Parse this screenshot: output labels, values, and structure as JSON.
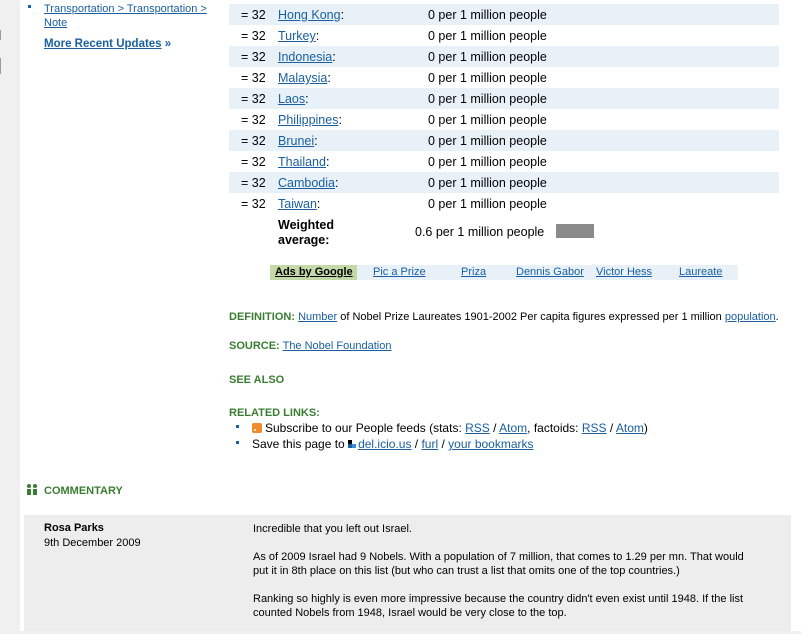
{
  "sidebar": {
    "recent_link": "Transportation > Transportation > Note",
    "more_recent": "More Recent Updates",
    "more_recent_suffix": "»"
  },
  "table": {
    "rows": [
      {
        "rank": "= 32",
        "country": "Hong Kong",
        "value": "0 per 1 million people"
      },
      {
        "rank": "= 32",
        "country": "Turkey",
        "value": "0 per 1 million people"
      },
      {
        "rank": "= 32",
        "country": "Indonesia",
        "value": "0 per 1 million people"
      },
      {
        "rank": "= 32",
        "country": "Malaysia",
        "value": "0 per 1 million people"
      },
      {
        "rank": "= 32",
        "country": "Laos",
        "value": "0 per 1 million people"
      },
      {
        "rank": "= 32",
        "country": "Philippines",
        "value": "0 per 1 million people"
      },
      {
        "rank": "= 32",
        "country": "Brunei",
        "value": "0 per 1 million people"
      },
      {
        "rank": "= 32",
        "country": "Thailand",
        "value": "0 per 1 million people"
      },
      {
        "rank": "= 32",
        "country": "Cambodia",
        "value": "0 per 1 million people"
      },
      {
        "rank": "= 32",
        "country": "Taiwan",
        "value": "0 per 1 million people"
      }
    ],
    "weighted_label_1": "Weighted",
    "weighted_label_2": "average:",
    "weighted_value": "0.6 per 1 million people"
  },
  "ads": {
    "label": "Ads by Google",
    "links": [
      "Pic a Prize",
      "Priza",
      "Dennis Gabor",
      "Victor Hess",
      "Laureate"
    ]
  },
  "definition": {
    "label": "DEFINITION:",
    "link1": "Number",
    "text": " of Nobel Prize Laureates 1901-2002 Per capita figures expressed per 1 million ",
    "link2": "population",
    "end": "."
  },
  "source": {
    "label": "SOURCE:",
    "link": "The Nobel Foundation"
  },
  "see_also": "SEE ALSO",
  "related": {
    "label": "RELATED LINKS:",
    "subscribe_text": "Subscribe to our People feeds (stats: ",
    "rss1": "RSS",
    "sep": " / ",
    "atom1": "Atom",
    "factoids": ", factoids: ",
    "rss2": "RSS",
    "atom2": "Atom",
    "close": ")",
    "save_text": "Save this page to ",
    "delicious": "del.icio.us",
    "furl": "furl",
    "bookmarks": "your bookmarks"
  },
  "commentary": {
    "heading": "COMMENTARY",
    "name": "Rosa Parks",
    "date": "9th December 2009",
    "p1": "Incredible that you left out Israel.",
    "p2": "As of 2009 Israel had 9 Nobels. With a population of 7 million, that comes to 1.29 per mn. That would put it in 8th place on this list (but who can trust a list that omits one of the top countries.)",
    "p3": "Ranking so highly is even more impressive because the country didn't even exist until 1948. If the list counted Nobels from 1948, Israel would be very close to the top."
  },
  "colors": {
    "link": "#1a5fa0",
    "green": "#3a7d32",
    "row_alt": "#e8f1f8",
    "bar": "#8a8a8a"
  }
}
